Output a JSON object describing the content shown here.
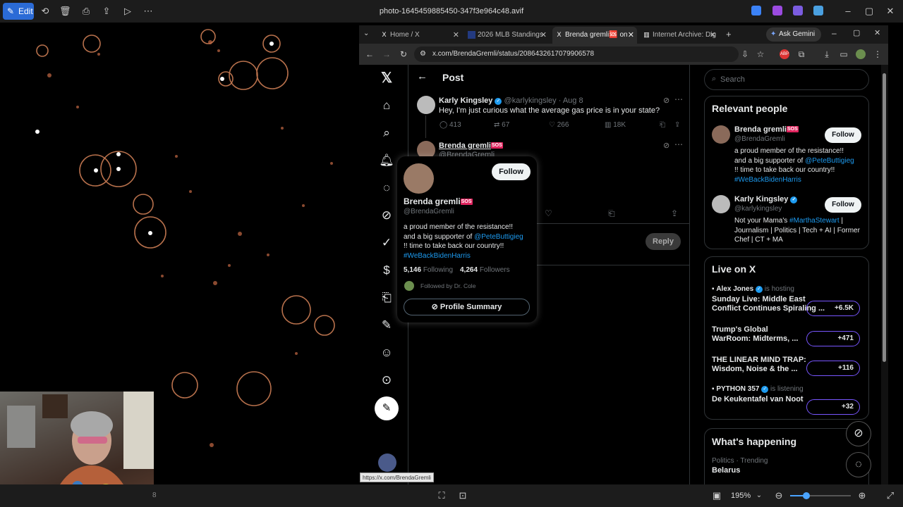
{
  "viewer": {
    "edit_label": "Edit",
    "title": "photo-1645459885450-347f3e964c48.avif",
    "zoom": "195%",
    "bottom_left": "8"
  },
  "browser": {
    "tabs": [
      {
        "label": "Home / X"
      },
      {
        "label": "2026 MLB Standings"
      },
      {
        "label": "Brenda gremli🆘 on"
      },
      {
        "label": "Internet Archive: Dig"
      }
    ],
    "gemini_label": "Ask Gemini",
    "url": "x.com/BrendaGremli/status/2086432617079906578",
    "status_url": "https://x.com/BrendaGremli"
  },
  "page": {
    "header": "Post",
    "tweet": {
      "name": "Karly Kingsley",
      "handle": "@karlykingsley · Aug 8",
      "text": "Hey, I'm just curious what the average gas price is in your state?",
      "replies": "413",
      "reposts": "67",
      "likes": "266",
      "views": "18K"
    },
    "reply": {
      "name": "Brenda gremli",
      "handle": "@BrendaGremli",
      "reply_button": "Reply"
    },
    "hovercard": {
      "name": "Brenda gremli",
      "handle": "@BrendaGremli",
      "follow": "Follow",
      "bio1": "a proud member of the resistance!!",
      "bio2a": "and a big supporter of ",
      "bio2b": "@PeteButtigieg",
      "bio3": "!! time to take back our country!!",
      "bio4": "#WeBackBidenHarris",
      "following_n": "5,146",
      "following_l": "Following",
      "followers_n": "4,264",
      "followers_l": "Followers",
      "followed_by": "Followed by Dr. Cole",
      "summary": "Profile Summary"
    },
    "search_placeholder": "Search",
    "relevant": {
      "title": "Relevant people",
      "p1": {
        "name": "Brenda gremli",
        "handle": "@BrendaGremli",
        "follow": "Follow",
        "b1": "a proud member of the resistance!!",
        "b2a": "and a big supporter of ",
        "b2b": "@PeteButtigieg",
        "b3": "!! time to take back our country!!",
        "b4": "#WeBackBidenHarris"
      },
      "p2": {
        "name": "Karly Kingsley",
        "handle": "@karlykingsley",
        "follow": "Follow",
        "b1a": "Not your Mama's ",
        "b1b": "#MarthaStewart",
        "b1c": " |",
        "b2": "Journalism | Politics | Tech + AI | Former",
        "b3": "Chef | CT + MA"
      }
    },
    "live": {
      "title": "Live on X",
      "items": [
        {
          "host": "Alex Jones",
          "status": "is hosting",
          "title1": "Sunday Live: Middle East",
          "title2": "Conflict Continues Spiraling ...",
          "count": "+6.5K"
        },
        {
          "title1": "Trump's Global",
          "title2": "WarRoom: Midterms, ...",
          "count": "+471"
        },
        {
          "title1": "THE LINEAR MIND TRAP:",
          "title2": "Wisdom, Noise & the ...",
          "count": "+116"
        },
        {
          "host": "PYTHON 357",
          "status": "is listening",
          "title1": "De Keukentafel van Noot",
          "count": "+32"
        }
      ]
    },
    "happening": {
      "title": "What's happening",
      "meta": "Politics · Trending",
      "topic": "Belarus"
    }
  }
}
